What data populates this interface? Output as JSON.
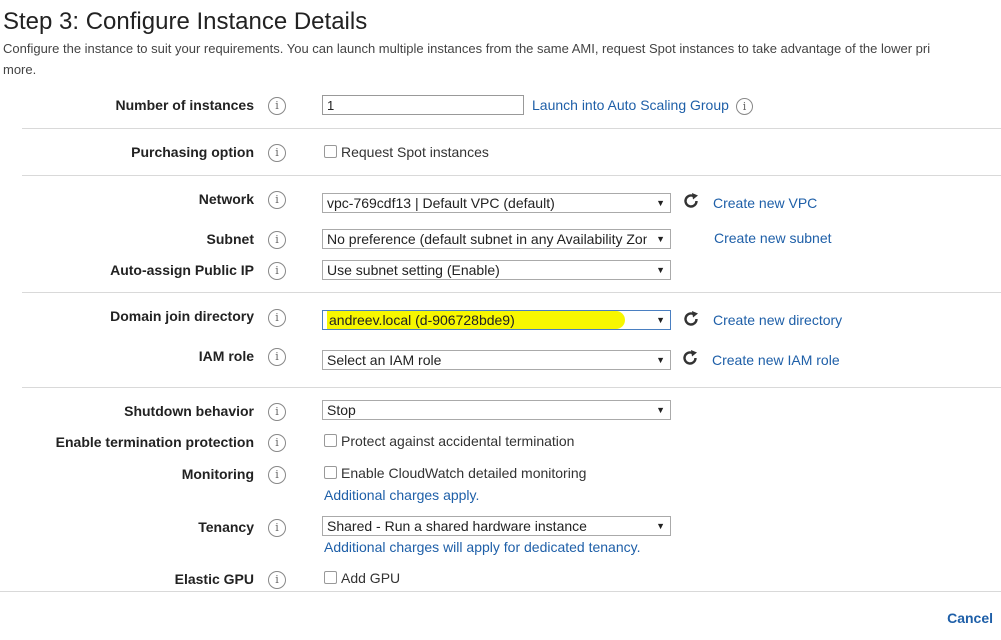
{
  "page": {
    "title": "Step 3: Configure Instance Details",
    "description_line1": "Configure the instance to suit your requirements. You can launch multiple instances from the same AMI, request Spot instances to take advantage of the lower pri",
    "description_line2": "more."
  },
  "icons": {
    "info": "info-icon",
    "refresh": "refresh-icon",
    "caret": "caret-down-icon"
  },
  "fields": {
    "number_of_instances": {
      "label": "Number of instances",
      "value": "1",
      "link": "Launch into Auto Scaling Group"
    },
    "purchasing_option": {
      "label": "Purchasing option",
      "checkbox": "Request Spot instances"
    },
    "network": {
      "label": "Network",
      "value": "vpc-769cdf13 | Default VPC (default)",
      "link": "Create new VPC"
    },
    "subnet": {
      "label": "Subnet",
      "value": "No preference (default subnet in any Availability Zone",
      "link": "Create new subnet"
    },
    "public_ip": {
      "label": "Auto-assign Public IP",
      "value": "Use subnet setting (Enable)"
    },
    "domain_join": {
      "label": "Domain join directory",
      "value": "andreev.local (d-906728bde9)",
      "link": "Create new directory"
    },
    "iam_role": {
      "label": "IAM role",
      "value": "Select an IAM role",
      "link": "Create new IAM role"
    },
    "shutdown": {
      "label": "Shutdown behavior",
      "value": "Stop"
    },
    "termination": {
      "label": "Enable termination protection",
      "checkbox": "Protect against accidental termination"
    },
    "monitoring": {
      "label": "Monitoring",
      "checkbox": "Enable CloudWatch detailed monitoring",
      "note": "Additional charges apply."
    },
    "tenancy": {
      "label": "Tenancy",
      "value": "Shared - Run a shared hardware instance",
      "note": "Additional charges will apply for dedicated tenancy."
    },
    "elastic_gpu": {
      "label": "Elastic GPU",
      "checkbox": "Add GPU"
    }
  },
  "footer": {
    "cancel": "Cancel"
  },
  "colors": {
    "link": "#1e5fa8",
    "highlight": "#f7f700"
  }
}
